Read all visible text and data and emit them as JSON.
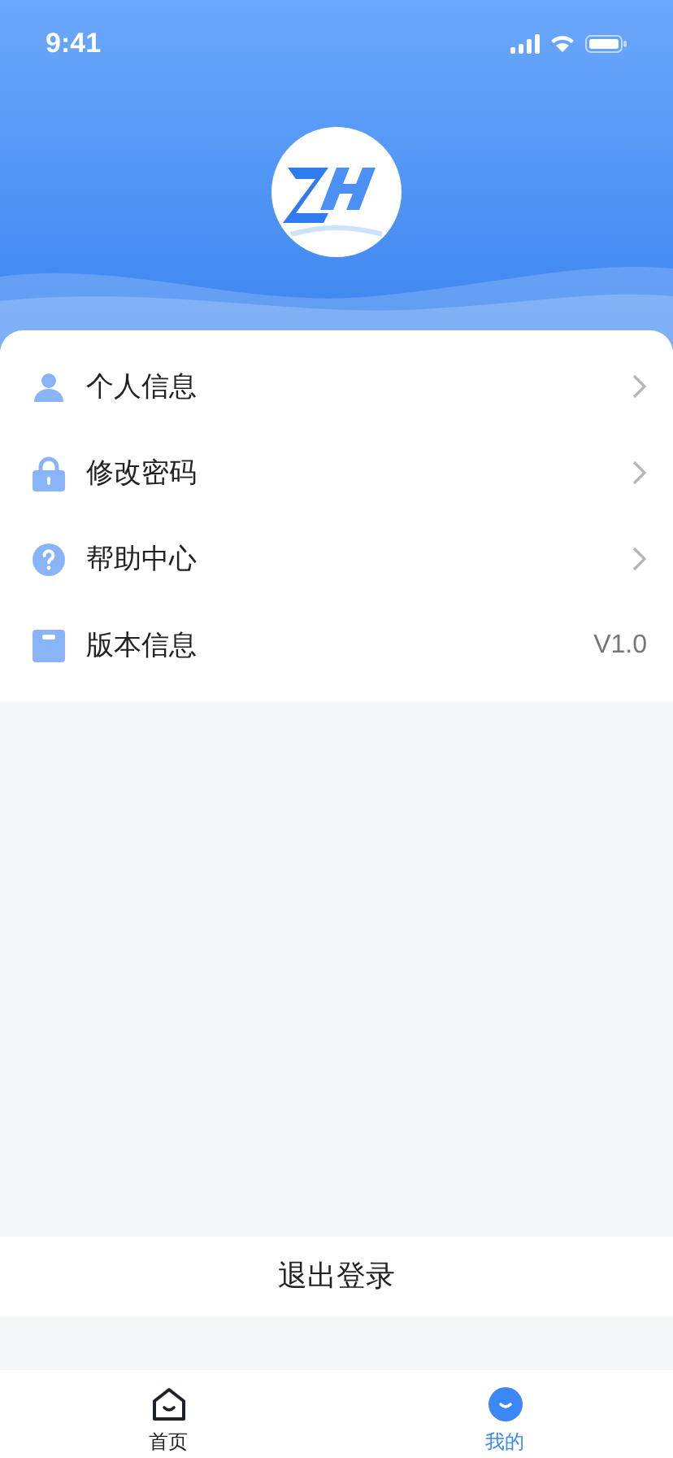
{
  "status_bar": {
    "time": "9:41"
  },
  "menu": [
    {
      "kind": "link",
      "label": "个人信息"
    },
    {
      "kind": "link",
      "label": "修改密码"
    },
    {
      "kind": "link",
      "label": "帮助中心"
    },
    {
      "kind": "value",
      "label": "版本信息",
      "value": "V1.0"
    }
  ],
  "logout": {
    "label": "退出登录"
  },
  "tabs": [
    {
      "label": "首页",
      "selected": false
    },
    {
      "label": "我的",
      "selected": true
    }
  ]
}
